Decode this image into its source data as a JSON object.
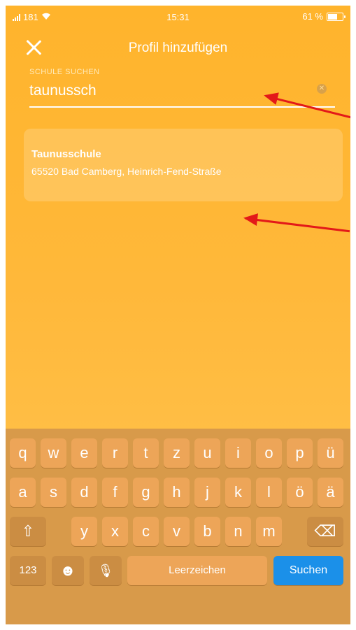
{
  "status_bar": {
    "carrier": "181",
    "time": "15:31",
    "battery": "61 %"
  },
  "nav": {
    "title": "Profil hinzufügen"
  },
  "search": {
    "label": "SCHULE SUCHEN",
    "value": "taunussch"
  },
  "results": [
    {
      "name": "Taunusschule",
      "address": "65520 Bad Camberg, Heinrich-Fend-Straße"
    }
  ],
  "keyboard": {
    "row1": [
      "q",
      "w",
      "e",
      "r",
      "t",
      "z",
      "u",
      "i",
      "o",
      "p",
      "ü"
    ],
    "row2": [
      "a",
      "s",
      "d",
      "f",
      "g",
      "h",
      "j",
      "k",
      "l",
      "ö",
      "ä"
    ],
    "row3": [
      "y",
      "x",
      "c",
      "v",
      "b",
      "n",
      "m"
    ],
    "shift": "⇧",
    "backspace": "⌫",
    "numbers": "123",
    "emoji": "☻",
    "mic": "🎙",
    "space": "Leerzeichen",
    "search": "Suchen"
  },
  "colors": {
    "background": "#ffb83a",
    "arrow": "#e31919",
    "search_key": "#1b90e9"
  }
}
